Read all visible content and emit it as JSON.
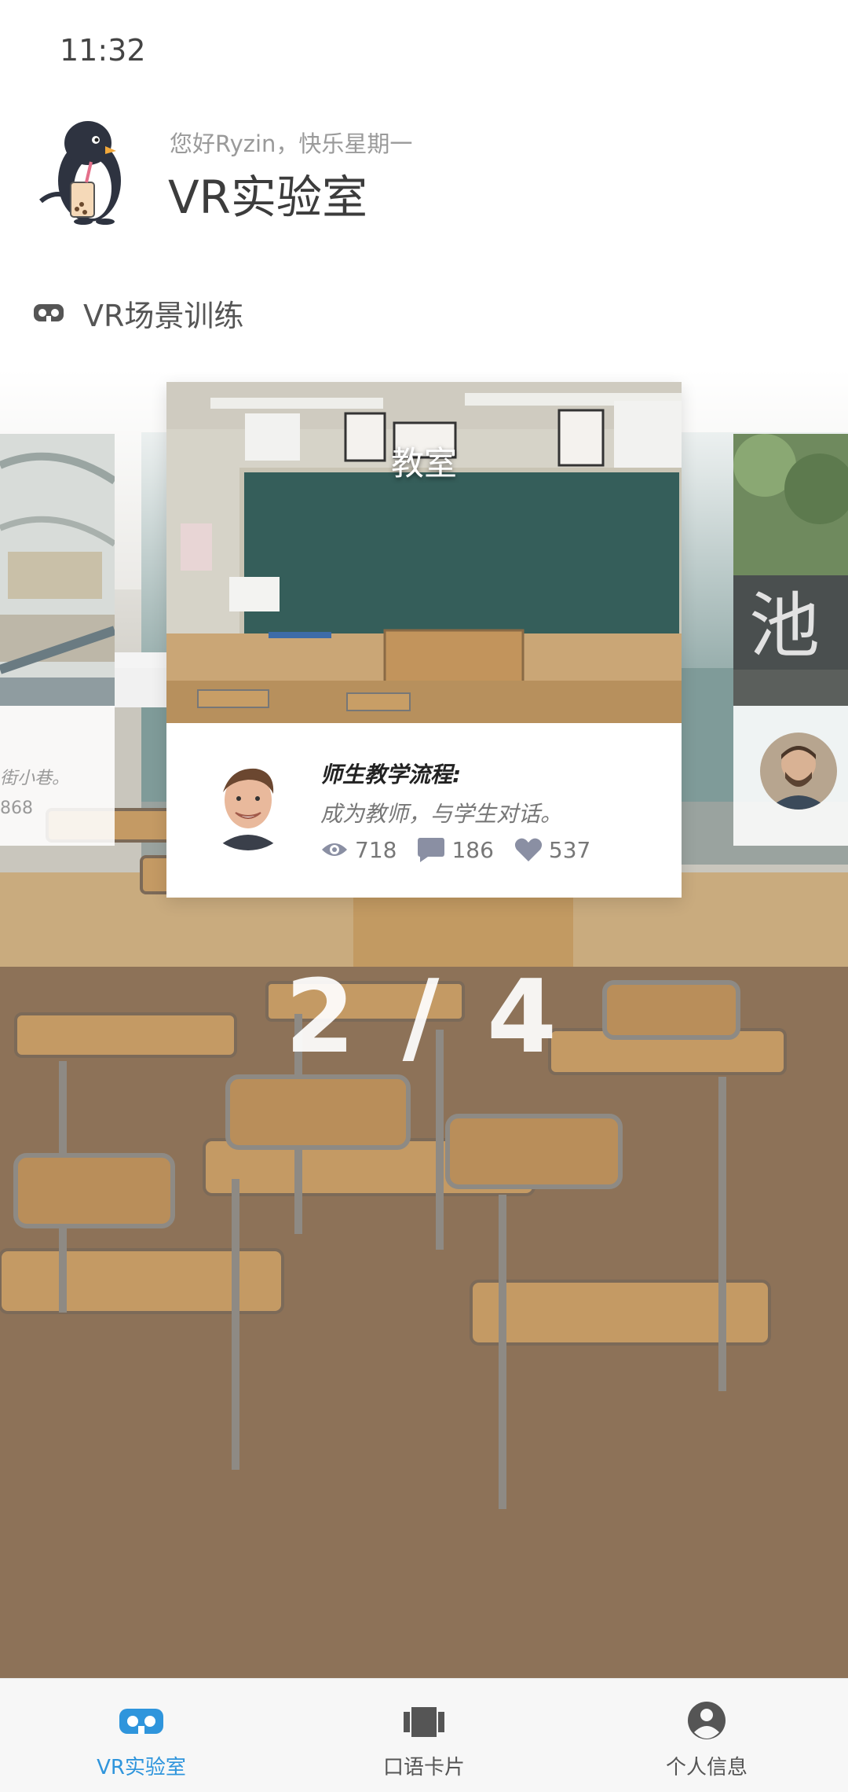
{
  "status_bar": {
    "time": "11:32"
  },
  "header": {
    "greeting": "您好Ryzin，快乐星期一",
    "title": "VR实验室"
  },
  "section": {
    "label": "VR场景训练",
    "icon": "vr-headset-icon"
  },
  "carousel": {
    "active_card": {
      "image_title": "教室",
      "heading": "师生教学流程:",
      "description": "成为教师，与学生对话。",
      "views": "718",
      "comments": "186",
      "likes": "537"
    },
    "left_card": {
      "desc_fragment": "街小巷。",
      "stat_fragment": "868"
    },
    "pager": "2 / 4"
  },
  "bottom_nav": {
    "items": [
      {
        "label": "VR实验室",
        "icon": "vr-headset-icon",
        "active": true
      },
      {
        "label": "口语卡片",
        "icon": "cards-icon",
        "active": false
      },
      {
        "label": "个人信息",
        "icon": "user-circle-icon",
        "active": false
      }
    ]
  },
  "colors": {
    "accent": "#2f95dc",
    "chalkboard": "#355e5a"
  }
}
